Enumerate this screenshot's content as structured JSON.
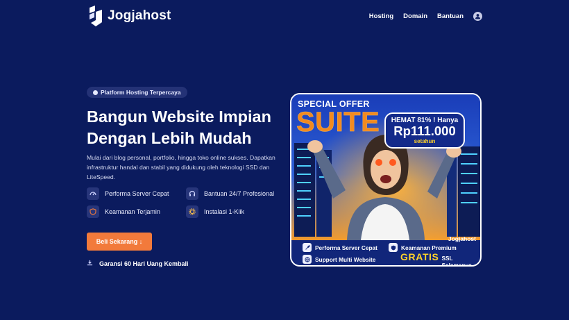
{
  "brand": {
    "name": "Jogjahost"
  },
  "nav": {
    "items": [
      "Hosting",
      "Domain",
      "Bantuan"
    ]
  },
  "hero": {
    "badge": "Platform Hosting Terpercaya",
    "title_line1": "Bangun Website Impian",
    "title_line2": "Dengan Lebih Mudah",
    "description": "Mulai dari blog personal, portfolio, hingga toko online sukses. Dapatkan infrastruktur handal dan stabil yang didukung oleh teknologi SSD dan LiteSpeed.",
    "features": [
      {
        "label": "Performa Server Cepat",
        "icon": "speedometer-icon"
      },
      {
        "label": "Bantuan 24/7 Profesional",
        "icon": "headset-icon"
      },
      {
        "label": "Keamanan Terjamin",
        "icon": "shield-icon"
      },
      {
        "label": "Instalasi 1-Klik",
        "icon": "gear-icon"
      }
    ],
    "cta": "Beli Sekarang ↓",
    "guarantee": "Garansi 60 Hari Uang Kembali"
  },
  "promo": {
    "special": "SPECIAL OFFER",
    "product": "SUITE",
    "save": "HEMAT 81% ! Hanya",
    "price": "Rp111.000",
    "period": "setahun",
    "brand": "Jogjahost",
    "features": [
      {
        "label": "Performa Server Cepat",
        "icon": "rocket-icon"
      },
      {
        "label": "Keamanan Premium",
        "icon": "shield-icon"
      },
      {
        "label": "Support Multi Website",
        "icon": "globe-icon"
      }
    ],
    "gratis": "GRATIS",
    "gratis_text": "SSL Selamanya"
  },
  "colors": {
    "background": "#0b1b5e",
    "accent": "#f27a3b",
    "chip": "#243276",
    "promo_orange": "#f28a1f",
    "promo_yellow": "#ffd32a"
  }
}
